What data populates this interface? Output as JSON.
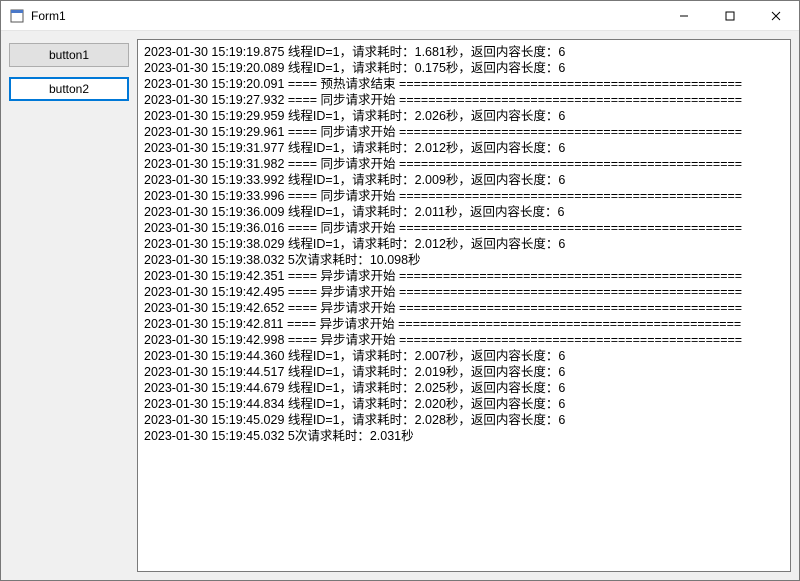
{
  "window": {
    "title": "Form1"
  },
  "buttons": {
    "button1": "button1",
    "button2": "button2"
  },
  "log_lines": [
    "2023-01-30 15:19:19.875  线程ID=1，请求耗时：1.681秒，返回内容长度：6",
    "2023-01-30 15:19:20.089  线程ID=1，请求耗时：0.175秒，返回内容长度：6",
    "2023-01-30 15:19:20.091  ==== 预热请求结束 ===============================================",
    "2023-01-30 15:19:27.932  ==== 同步请求开始 ===============================================",
    "2023-01-30 15:19:29.959  线程ID=1，请求耗时：2.026秒，返回内容长度：6",
    "2023-01-30 15:19:29.961  ==== 同步请求开始 ===============================================",
    "2023-01-30 15:19:31.977  线程ID=1，请求耗时：2.012秒，返回内容长度：6",
    "2023-01-30 15:19:31.982  ==== 同步请求开始 ===============================================",
    "2023-01-30 15:19:33.992  线程ID=1，请求耗时：2.009秒，返回内容长度：6",
    "2023-01-30 15:19:33.996  ==== 同步请求开始 ===============================================",
    "2023-01-30 15:19:36.009  线程ID=1，请求耗时：2.011秒，返回内容长度：6",
    "2023-01-30 15:19:36.016  ==== 同步请求开始 ===============================================",
    "2023-01-30 15:19:38.029  线程ID=1，请求耗时：2.012秒，返回内容长度：6",
    "2023-01-30 15:19:38.032  5次请求耗时：10.098秒",
    "2023-01-30 15:19:42.351  ==== 异步请求开始 ===============================================",
    "2023-01-30 15:19:42.495  ==== 异步请求开始 ===============================================",
    "2023-01-30 15:19:42.652  ==== 异步请求开始 ===============================================",
    "2023-01-30 15:19:42.811  ==== 异步请求开始 ===============================================",
    "2023-01-30 15:19:42.998  ==== 异步请求开始 ===============================================",
    "2023-01-30 15:19:44.360  线程ID=1，请求耗时：2.007秒，返回内容长度：6",
    "2023-01-30 15:19:44.517  线程ID=1，请求耗时：2.019秒，返回内容长度：6",
    "2023-01-30 15:19:44.679  线程ID=1，请求耗时：2.025秒，返回内容长度：6",
    "2023-01-30 15:19:44.834  线程ID=1，请求耗时：2.020秒，返回内容长度：6",
    "2023-01-30 15:19:45.029  线程ID=1，请求耗时：2.028秒，返回内容长度：6",
    "2023-01-30 15:19:45.032  5次请求耗时：2.031秒"
  ]
}
